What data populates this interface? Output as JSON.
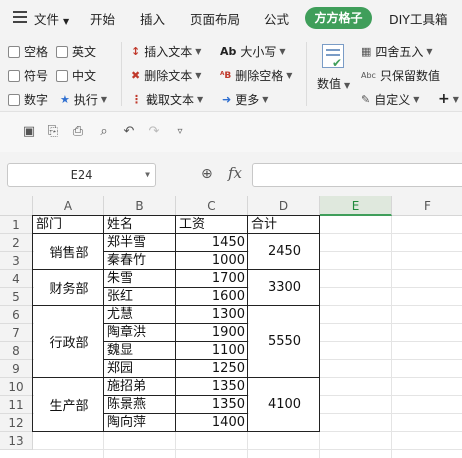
{
  "menubar": {
    "file_label": "文件",
    "items": [
      "开始",
      "插入",
      "页面布局",
      "公式",
      "方方格子",
      "DIY工具箱"
    ],
    "active_tab": "方方格子"
  },
  "ribbon": {
    "checks": [
      "空格",
      "英文",
      "符号",
      "中文",
      "数字"
    ],
    "execute": "执行",
    "insert_text": "插入文本",
    "delete_text": "删除文本",
    "extract_text": "截取文本",
    "case": "大小写",
    "delete_space": "删除空格",
    "more": "更多",
    "numeric": "数值",
    "round": "四舍五入",
    "keep_numeric": "只保留数值",
    "custom": "自定义",
    "plus": "+"
  },
  "formula_bar": {
    "cell_ref": "E24",
    "fx": "fx",
    "formula": ""
  },
  "grid": {
    "columns": [
      "A",
      "B",
      "C",
      "D",
      "E",
      "F"
    ],
    "active_column": "E",
    "rows": [
      "1",
      "2",
      "3",
      "4",
      "5",
      "6",
      "7",
      "8",
      "9",
      "10",
      "11",
      "12",
      "13"
    ],
    "headers": {
      "A": "部门",
      "B": "姓名",
      "C": "工资",
      "D": "合计"
    },
    "names": [
      "郑半雪",
      "秦春竹",
      "朱雪",
      "张红",
      "尤慧",
      "陶章洪",
      "魏显",
      "郑园",
      "施招弟",
      "陈景燕",
      "陶向萍"
    ],
    "salaries": [
      "1450",
      "1000",
      "1700",
      "1600",
      "1300",
      "1900",
      "1100",
      "1250",
      "1350",
      "1350",
      "1400"
    ],
    "departments": [
      "销售部",
      "财务部",
      "行政部",
      "生产部"
    ],
    "totals": [
      "2450",
      "3300",
      "5550",
      "4100"
    ]
  },
  "colors": {
    "accent": "#3f9e5a",
    "active_header_bg": "#dfe8dd"
  }
}
